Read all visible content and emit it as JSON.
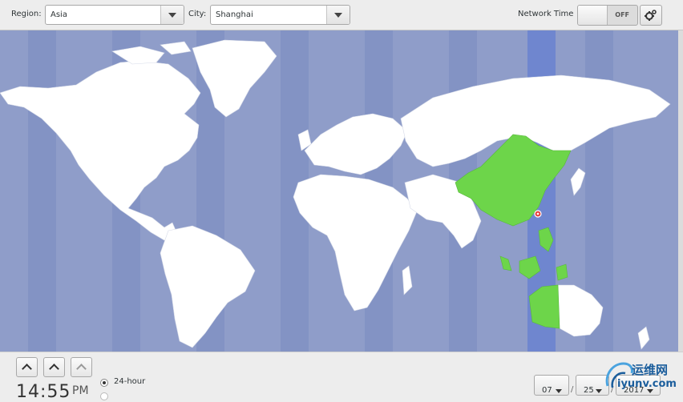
{
  "header": {
    "region_label": "Region:",
    "region_value": "Asia",
    "city_label": "City:",
    "city_value": "Shanghai",
    "network_time_label": "Network Time",
    "network_time_state": "OFF"
  },
  "time": {
    "clock": "14:55",
    "ampm": "PM",
    "format_24": "24-hour"
  },
  "date": {
    "month": "07",
    "day": "25",
    "year": "2017"
  },
  "watermark": {
    "cn": "运维网",
    "en": "iyunv.com"
  },
  "colors": {
    "ocean": "#8f9dc9",
    "land": "#ffffff",
    "selected_zone": "#6dd54a",
    "zone_band": "#6f86cf",
    "city_marker": "#e53935"
  }
}
